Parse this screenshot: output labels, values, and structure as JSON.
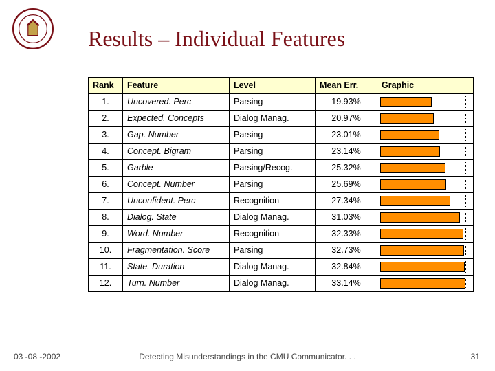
{
  "title": "Results – Individual Features",
  "headers": {
    "rank": "Rank",
    "feature": "Feature",
    "level": "Level",
    "mean_err": "Mean Err.",
    "graphic": "Graphic"
  },
  "chart_data": {
    "type": "table",
    "title": "Results – Individual Features",
    "columns": [
      "Rank",
      "Feature",
      "Level",
      "Mean Err. (%)"
    ],
    "rows": [
      {
        "rank": "1.",
        "feature": "Uncovered. Perc",
        "level": "Parsing",
        "mean_err": 19.93
      },
      {
        "rank": "2.",
        "feature": "Expected. Concepts",
        "level": "Dialog Manag.",
        "mean_err": 20.97
      },
      {
        "rank": "3.",
        "feature": "Gap. Number",
        "level": "Parsing",
        "mean_err": 23.01
      },
      {
        "rank": "4.",
        "feature": "Concept. Bigram",
        "level": "Parsing",
        "mean_err": 23.14
      },
      {
        "rank": "5.",
        "feature": "Garble",
        "level": "Parsing/Recog.",
        "mean_err": 25.32
      },
      {
        "rank": "6.",
        "feature": "Concept. Number",
        "level": "Parsing",
        "mean_err": 25.69
      },
      {
        "rank": "7.",
        "feature": "Unconfident. Perc",
        "level": "Recognition",
        "mean_err": 27.34
      },
      {
        "rank": "8.",
        "feature": "Dialog. State",
        "level": "Dialog Manag.",
        "mean_err": 31.03
      },
      {
        "rank": "9.",
        "feature": "Word. Number",
        "level": "Recognition",
        "mean_err": 32.33
      },
      {
        "rank": "10.",
        "feature": "Fragmentation. Score",
        "level": "Parsing",
        "mean_err": 32.73
      },
      {
        "rank": "11.",
        "feature": "State. Duration",
        "level": "Dialog Manag.",
        "mean_err": 32.84
      },
      {
        "rank": "12.",
        "feature": "Turn. Number",
        "level": "Dialog Manag.",
        "mean_err": 33.14
      }
    ],
    "bar_scale_max": 35,
    "tick_at": 33.14
  },
  "footer": {
    "date": "03 -08 -2002",
    "caption": "Detecting Misunderstandings in the CMU Communicator. . .",
    "page": "31"
  }
}
